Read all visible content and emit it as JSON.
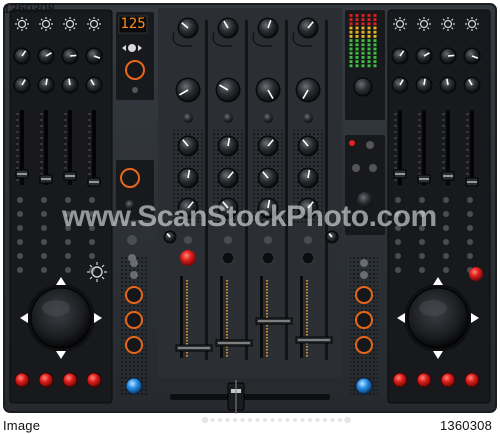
{
  "stamps": {
    "top_left": "1360308",
    "bottom_left": "Image",
    "bottom_right": "1360308"
  },
  "watermark": "www.ScanStockPhoto.com",
  "display": {
    "bpm": "125"
  },
  "colors": {
    "panel": "#2e3338",
    "deck_bg": "#15171a",
    "led_red": "#e0201e",
    "led_blue": "#2a8fe8",
    "accent_orange": "#e8661a",
    "meter_green": "#3fbf3f"
  }
}
